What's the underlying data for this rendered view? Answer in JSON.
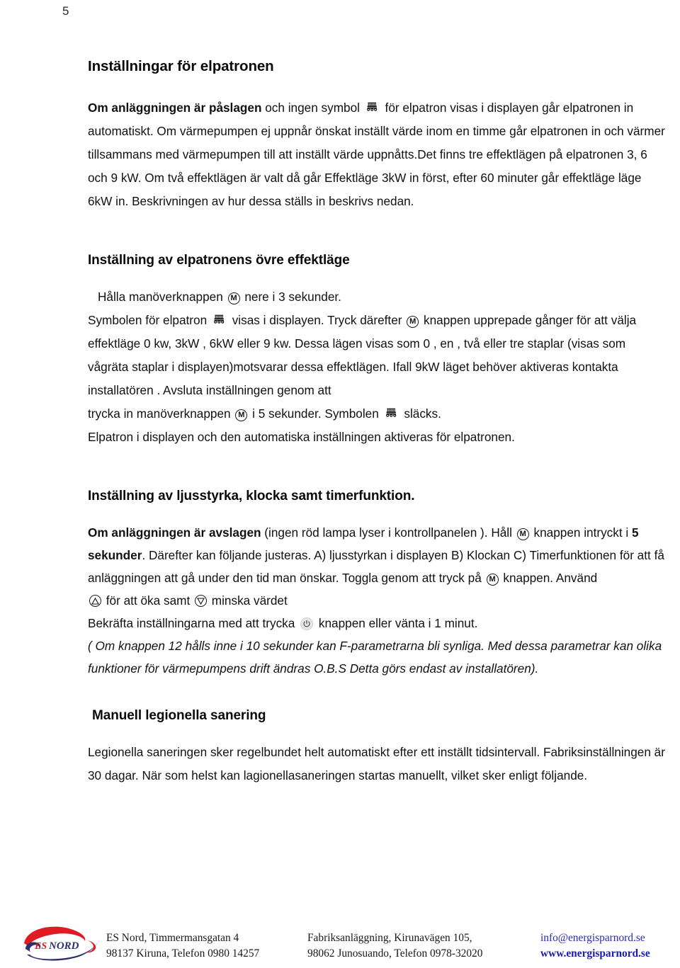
{
  "page": {
    "number": "5"
  },
  "sections": {
    "heading1": "Inställningar för elpatronen",
    "intro": {
      "bold_lead": "Om anläggningen är påslagen",
      "t1": " och ingen symbol ",
      "t2": " för elpatron visas i displayen går elpatronen in automatiskt. Om värmepumpen  ej uppnår önskat inställt värde inom en timme går elpatronen in och värmer tillsammans med värmepumpen till att inställt värde uppnåtts.Det finns tre effektlägen på elpatronen 3, 6 och 9 kW. Om två effektlägen är valt då går Effektläge 3kW  in först, efter 60 minuter går effektläge läge  6kW in. Beskrivningen av hur dessa ställs in beskrivs nedan."
    },
    "heading2": "Inställning av elpatronens övre effektläge",
    "upper_mode": {
      "line1_a": "Hålla manöverknappen ",
      "line1_b": " nere i  3 sekunder.",
      "line2_a": "Symbolen för elpatron ",
      "line2_b": " visas i displayen. Tryck därefter ",
      "line2_c": " knappen upprepade gånger för att välja effektläge 0 kw, 3kW ,  6kW eller 9 kw.  Dessa lägen visas som 0 , en , två eller tre staplar (visas som vågräta staplar i displayen)motsvarar dessa effektlägen.  Ifall 9kW läget behöver aktiveras kontakta installatören .  Avsluta inställningen genom att",
      "line3_a": "trycka in manöverknappen ",
      "line3_b": " i  5 sekunder.  Symbolen ",
      "line3_c": " släcks.",
      "line4": "Elpatron i displayen och den automatiska inställningen aktiveras för elpatronen."
    },
    "heading3": "Inställning av ljusstyrka, klocka samt timerfunktion.",
    "brightness": {
      "bold_lead": "Om anläggningen är avslagen",
      "t1": " (ingen röd lampa lyser i kontrollpanelen ). Håll ",
      "t2": " knappen  intryckt i ",
      "bold_5sek": "5 sekunder",
      "t3": ". Därefter kan följande justeras. A) ljusstyrkan i displayen B) Klockan C) Timerfunktionen  för att få anläggningen att gå under den tid man önskar. Toggla genom att tryck på ",
      "t4": " knappen. Använd",
      "line_arrows_a": " för att öka  samt ",
      "line_arrows_b": " minska värdet",
      "confirm_a": "Bekräfta inställningarna med att trycka ",
      "confirm_b": " knappen eller vänta i 1 minut.",
      "italic_note": " ( Om knappen 12 hålls inne i 10 sekunder kan F-parametrarna bli synliga.  Med dessa parametrar  kan olika funktioner för värmepumpens drift ändras O.B.S Detta görs endast av installatören)."
    },
    "heading4": "Manuell legionella sanering",
    "legionella": "Legionella saneringen sker regelbundet helt automatiskt efter ett inställt tidsintervall. Fabriksinställningen är 30 dagar.  När som helst kan lagionellasaneringen startas manuellt, vilket sker enligt följande."
  },
  "footer": {
    "logo_text_es": "ES",
    "logo_text_nord": "NORD",
    "col1_line1": "ES Nord, Timmermansgatan 4",
    "col1_line2": "98137 Kiruna, Telefon 0980 14257",
    "col2_line1": "Fabriksanläggning, Kirunavägen 105,",
    "col2_line2": "98062 Junosuando,  Telefon 0978-32020",
    "col3_line1": "info@energisparnord.se",
    "col3_line2": "www.energisparnord.se"
  },
  "colors": {
    "logo_red": "#e01b24",
    "logo_navy": "#2b2f6e",
    "link_blue": "#1a1ab8",
    "text": "#111111"
  },
  "icons": {
    "elpatron": "heating-element-icon",
    "m_button": "mode-m-button-icon",
    "up": "increase-arrow-icon",
    "down": "decrease-arrow-icon",
    "power": "power-button-icon"
  }
}
